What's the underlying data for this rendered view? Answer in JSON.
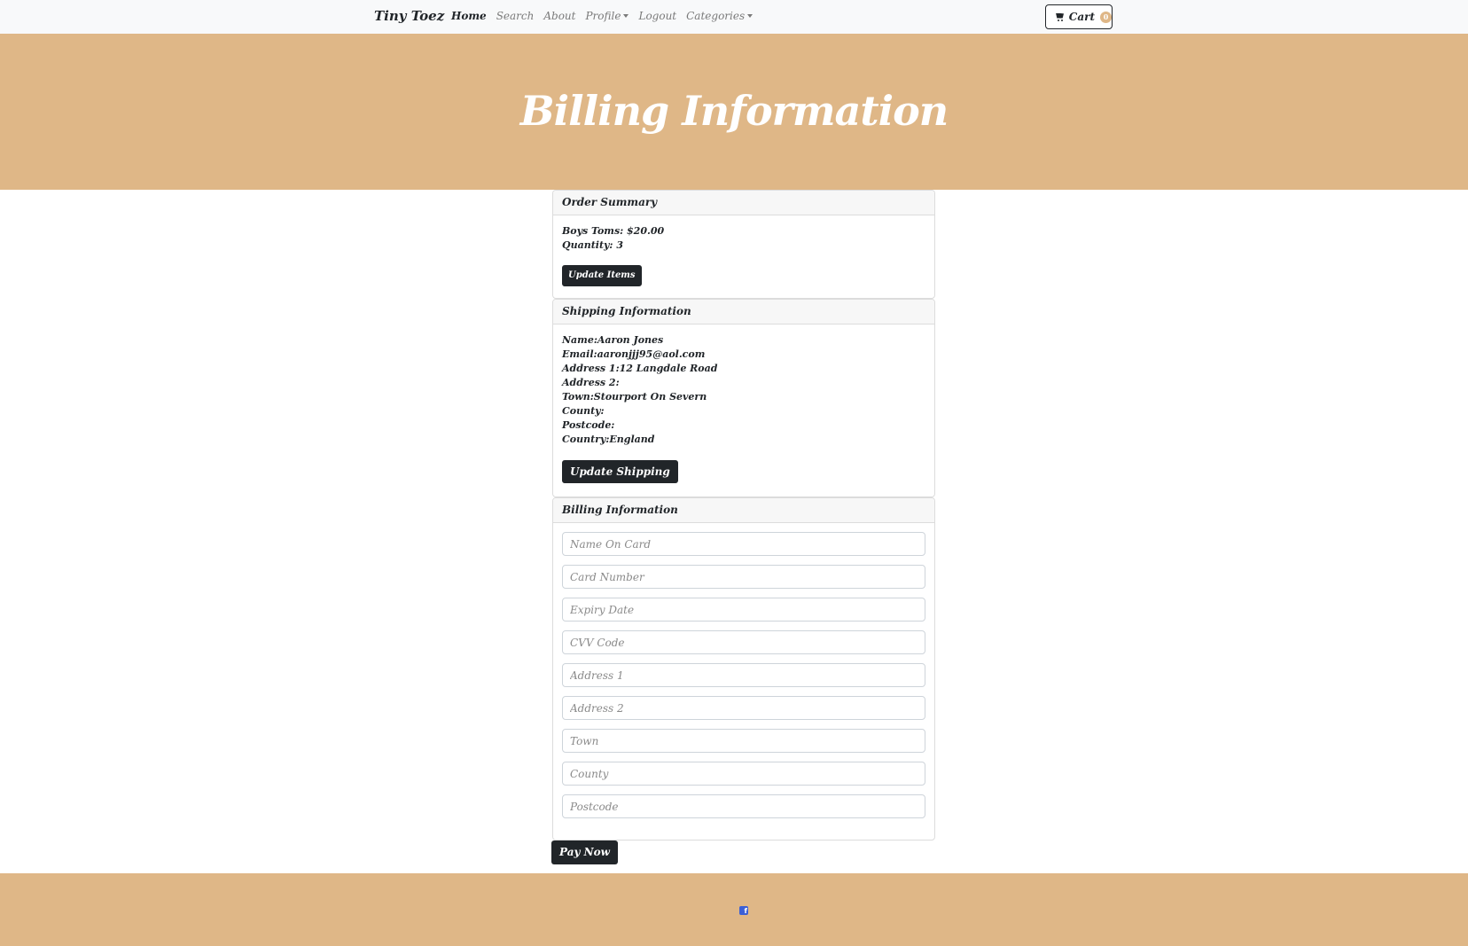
{
  "navbar": {
    "brand": "Tiny Toez",
    "links": [
      {
        "label": "Home"
      },
      {
        "label": "Search"
      },
      {
        "label": "About"
      },
      {
        "label": "Profile"
      },
      {
        "label": "Logout"
      },
      {
        "label": "Categories"
      }
    ],
    "cart": {
      "label": "Cart",
      "count": "0"
    }
  },
  "hero": {
    "title": "Billing Information"
  },
  "order_summary": {
    "header": "Order Summary",
    "item": "Boys Toms: $20.00",
    "quantity": "Quantity: 3",
    "button": "Update Items"
  },
  "shipping": {
    "header": "Shipping Information",
    "lines": [
      "Name:Aaron Jones",
      "Email:aaronjjj95@aol.com",
      "Address 1:12 Langdale Road",
      "Address 2:",
      "Town:Stourport On Severn",
      "County:",
      "Postcode:",
      "Country:England"
    ],
    "button": "Update Shipping"
  },
  "billing": {
    "header": "Billing Information",
    "fields": [
      {
        "placeholder": "Name On Card",
        "value": ""
      },
      {
        "placeholder": "Card Number",
        "value": ""
      },
      {
        "placeholder": "Expiry Date",
        "value": ""
      },
      {
        "placeholder": "CVV Code",
        "value": ""
      },
      {
        "placeholder": "Address 1",
        "value": ""
      },
      {
        "placeholder": "Address 2",
        "value": ""
      },
      {
        "placeholder": "Town",
        "value": ""
      },
      {
        "placeholder": "County",
        "value": ""
      },
      {
        "placeholder": "Postcode",
        "value": ""
      }
    ]
  },
  "pay_button": "Pay Now",
  "footer": {
    "icon": "facebook-icon"
  },
  "colors": {
    "accent": "#dfb787",
    "dark": "#212529",
    "facebook": "#3b5fd6"
  }
}
